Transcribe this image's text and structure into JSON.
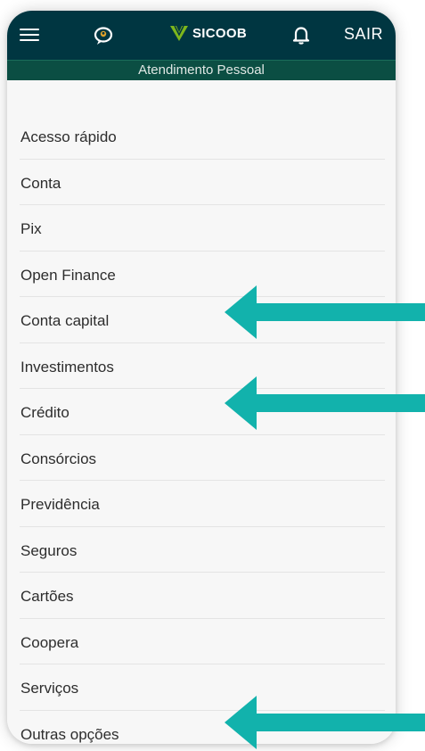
{
  "header": {
    "logo_text": "SICOOB",
    "logout_label": "SAIR",
    "subtitle": "Atendimento Pessoal",
    "icons": [
      "hamburger-menu-icon",
      "chat-support-icon",
      "sicoob-logo",
      "bell-icon"
    ]
  },
  "menu": {
    "items": [
      {
        "label": "Acesso rápido"
      },
      {
        "label": "Conta"
      },
      {
        "label": "Pix"
      },
      {
        "label": "Open Finance"
      },
      {
        "label": "Conta capital"
      },
      {
        "label": "Investimentos"
      },
      {
        "label": "Crédito"
      },
      {
        "label": "Consórcios"
      },
      {
        "label": "Previdência"
      },
      {
        "label": "Seguros"
      },
      {
        "label": "Cartões"
      },
      {
        "label": "Coopera"
      },
      {
        "label": "Serviços"
      },
      {
        "label": "Outras opções"
      }
    ]
  },
  "annotations": {
    "arrow_color": "#12b2ac",
    "highlighted_items": [
      "Conta capital",
      "Crédito",
      "Outras opções"
    ]
  },
  "colors": {
    "header_bg": "#003641",
    "subheader_bg": "#0b4e43",
    "logo_green": "#7db61c",
    "menu_bg": "#f7f7f7"
  }
}
